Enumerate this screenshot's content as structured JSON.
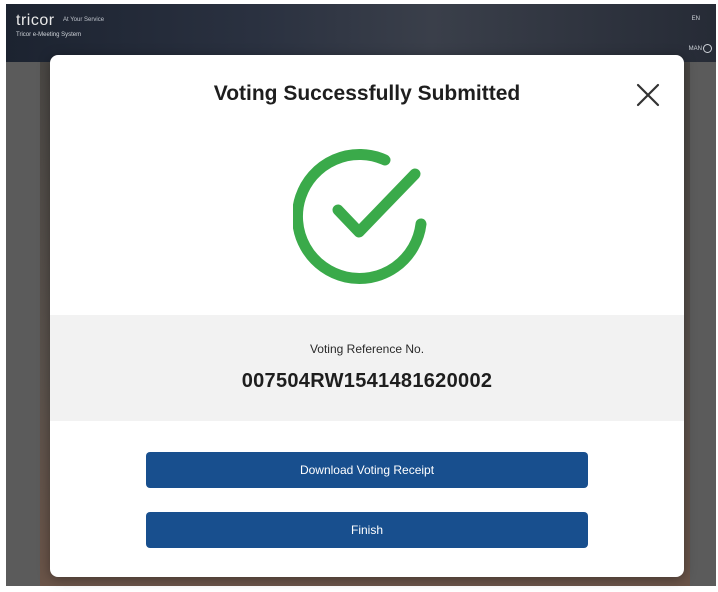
{
  "header": {
    "logo_text": "tricor",
    "tagline": "At Your Service",
    "subtitle": "Tricor e-Meeting System",
    "language": "EN",
    "user_name": "MAN"
  },
  "modal": {
    "title": "Voting Successfully Submitted",
    "close_icon": "close-icon",
    "status_icon": "check-circle-icon",
    "accent_color": "#3aaa4a",
    "reference_label": "Voting Reference No.",
    "reference_number": "007504RW1541481620002",
    "download_button_label": "Download Voting Receipt",
    "finish_button_label": "Finish",
    "button_color": "#184f8e"
  }
}
